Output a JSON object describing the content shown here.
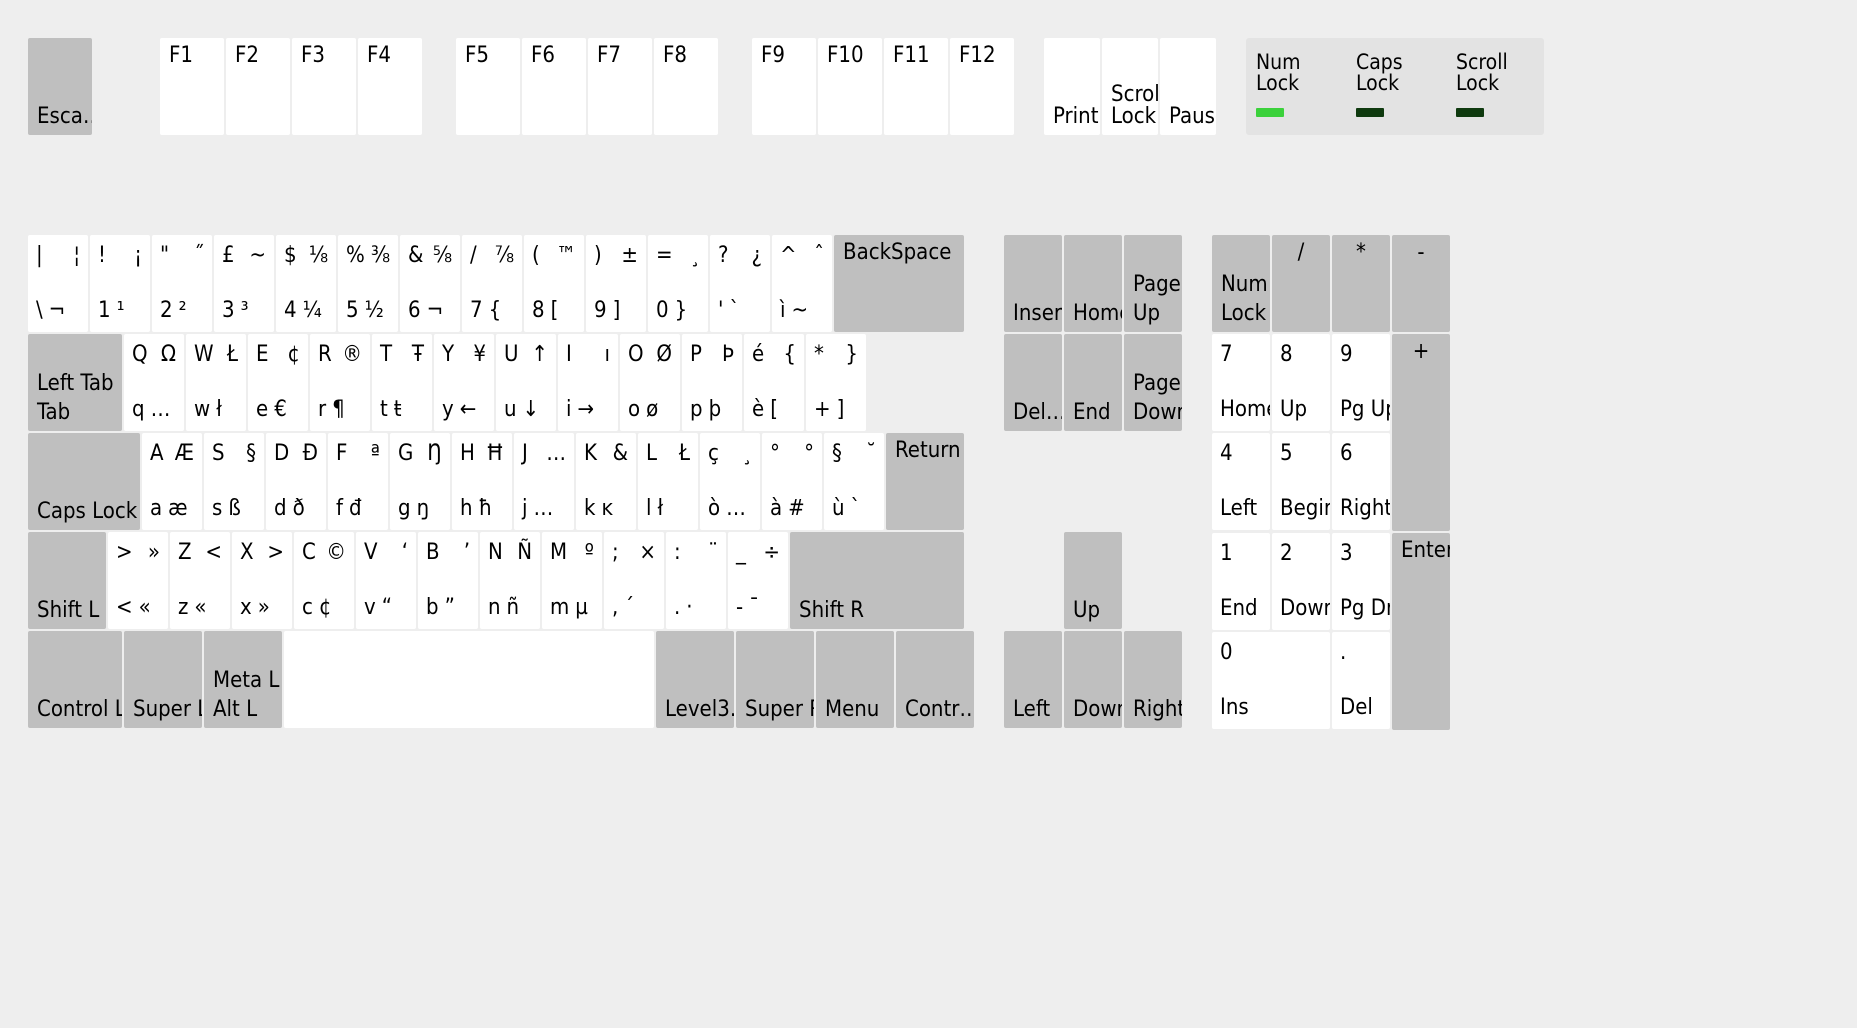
{
  "func": {
    "esc": "Esca…",
    "f1": "F1",
    "f2": "F2",
    "f3": "F3",
    "f4": "F4",
    "f5": "F5",
    "f6": "F6",
    "f7": "F7",
    "f8": "F8",
    "f9": "F9",
    "f10": "F10",
    "f11": "F11",
    "f12": "F12",
    "print": "Print",
    "scrolllock": "Scroll Lock",
    "pause": "Pause"
  },
  "indicators": {
    "num": {
      "label": "Num Lock",
      "on": true
    },
    "caps": {
      "label": "Caps Lock",
      "on": false
    },
    "scroll": {
      "label": "Scroll Lock",
      "on": false
    }
  },
  "r1": {
    "k0": {
      "a": "|",
      "b": "¦",
      "c": "\\",
      "d": "¬"
    },
    "k1": {
      "a": "!",
      "b": "¡",
      "c": "1",
      "d": "¹"
    },
    "k2": {
      "a": "\"",
      "b": "˝",
      "c": "2",
      "d": "²"
    },
    "k3": {
      "a": "£",
      "b": "~",
      "c": "3",
      "d": "³"
    },
    "k4": {
      "a": "$",
      "b": "⅛",
      "c": "4",
      "d": "¼"
    },
    "k5": {
      "a": "%",
      "b": "⅜",
      "c": "5",
      "d": "½"
    },
    "k6": {
      "a": "&",
      "b": "⅝",
      "c": "6",
      "d": "¬"
    },
    "k7": {
      "a": "/",
      "b": "⅞",
      "c": "7",
      "d": "{"
    },
    "k8": {
      "a": "(",
      "b": "™",
      "c": "8",
      "d": "["
    },
    "k9": {
      "a": ")",
      "b": "±",
      "c": "9",
      "d": "]"
    },
    "k10": {
      "a": "=",
      "b": "¸",
      "c": "0",
      "d": "}"
    },
    "k11": {
      "a": "?",
      "b": "¿",
      "c": "'",
      "d": "`"
    },
    "k12": {
      "a": "^",
      "b": "ˆ",
      "c": "ì",
      "d": "~"
    },
    "bksp": "BackSpace"
  },
  "r2": {
    "tab": {
      "top": "Left Tab",
      "bot": "Tab"
    },
    "q": {
      "a": "Q",
      "b": "Ω",
      "c": "q",
      "d": "…"
    },
    "w": {
      "a": "W",
      "b": "Ł",
      "c": "w",
      "d": "ł"
    },
    "e": {
      "a": "E",
      "b": "¢",
      "c": "e",
      "d": "€"
    },
    "r": {
      "a": "R",
      "b": "®",
      "c": "r",
      "d": "¶"
    },
    "t": {
      "a": "T",
      "b": "Ŧ",
      "c": "t",
      "d": "ŧ"
    },
    "y": {
      "a": "Y",
      "b": "¥",
      "c": "y",
      "d": "←"
    },
    "u": {
      "a": "U",
      "b": "↑",
      "c": "u",
      "d": "↓"
    },
    "i": {
      "a": "I",
      "b": "ı",
      "c": "i",
      "d": "→"
    },
    "o": {
      "a": "O",
      "b": "Ø",
      "c": "o",
      "d": "ø"
    },
    "p": {
      "a": "P",
      "b": "Þ",
      "c": "p",
      "d": "þ"
    },
    "br1": {
      "a": "é",
      "b": "{",
      "c": "è",
      "d": "["
    },
    "br2": {
      "a": "*",
      "b": "}",
      "c": "+",
      "d": "]"
    }
  },
  "r3": {
    "caps": "Caps Lock",
    "a": {
      "a": "A",
      "b": "Æ",
      "c": "a",
      "d": "æ"
    },
    "s": {
      "a": "S",
      "b": "§",
      "c": "s",
      "d": "ß"
    },
    "d": {
      "a": "D",
      "b": "Đ",
      "c": "d",
      "d": "ð"
    },
    "f": {
      "a": "F",
      "b": "ª",
      "c": "f",
      "d": "đ"
    },
    "g": {
      "a": "G",
      "b": "Ŋ",
      "c": "g",
      "d": "ŋ"
    },
    "h": {
      "a": "H",
      "b": "Ħ",
      "c": "h",
      "d": "ħ"
    },
    "j": {
      "a": "J",
      "b": "…",
      "c": "j",
      "d": "…"
    },
    "k": {
      "a": "K",
      "b": "&",
      "c": "k",
      "d": "ĸ"
    },
    "l": {
      "a": "L",
      "b": "Ł",
      "c": "l",
      "d": "ł"
    },
    "sc1": {
      "a": "ç",
      "b": "¸",
      "c": "ò",
      "d": "…"
    },
    "sc2": {
      "a": "°",
      "b": "°",
      "c": "à",
      "d": "#"
    },
    "sc3": {
      "a": "§",
      "b": "˘",
      "c": "ù",
      "d": "`"
    },
    "ret": "Return"
  },
  "r4": {
    "lshift": "Shift L",
    "lt": {
      "a": ">",
      "b": "»",
      "c": "<",
      "d": "«"
    },
    "z": {
      "a": "Z",
      "b": "<",
      "c": "z",
      "d": "«"
    },
    "x": {
      "a": "X",
      "b": ">",
      "c": "x",
      "d": "»"
    },
    "c": {
      "a": "C",
      "b": "©",
      "c": "c",
      "d": "¢"
    },
    "v": {
      "a": "V",
      "b": "‘",
      "c": "v",
      "d": "“"
    },
    "b": {
      "a": "B",
      "b": "’",
      "c": "b",
      "d": "”"
    },
    "n": {
      "a": "N",
      "b": "Ñ",
      "c": "n",
      "d": "ñ"
    },
    "m": {
      "a": "M",
      "b": "º",
      "c": "m",
      "d": "µ"
    },
    "cm": {
      "a": ";",
      "b": "×",
      "c": ",",
      "d": "´"
    },
    "pd": {
      "a": ":",
      "b": "¨",
      "c": ".",
      "d": "·"
    },
    "sl": {
      "a": "_",
      "b": "÷",
      "c": "-",
      "d": "¯"
    },
    "rshift": "Shift R"
  },
  "r5": {
    "lctrl": "Control L",
    "lsuper": "Super L",
    "lalt_top": "Meta L",
    "lalt_bot": "Alt L",
    "level3": "Level3…",
    "rsuper": "Super R",
    "menu": "Menu",
    "rctrl": "Contr…"
  },
  "nav": {
    "ins": "Insert",
    "home": "Home",
    "pgup_top": "Page",
    "pgup_bot": "Up",
    "del": "Del…",
    "end": "End",
    "pgdn_top": "Page",
    "pgdn_bot": "Down",
    "up": "Up",
    "left": "Left",
    "down": "Down",
    "right": "Right"
  },
  "np": {
    "numlock_top": "Num",
    "numlock_bot": "Lock",
    "div": "/",
    "mul": "*",
    "sub": "-",
    "k7": {
      "a": "7",
      "c": "Home"
    },
    "k8": {
      "a": "8",
      "c": "Up"
    },
    "k9": {
      "a": "9",
      "c": "Pg Up"
    },
    "add": "+",
    "k4": {
      "a": "4",
      "c": "Left"
    },
    "k5": {
      "a": "5",
      "c": "Begin"
    },
    "k6": {
      "a": "6",
      "c": "Right"
    },
    "k1": {
      "a": "1",
      "c": "End"
    },
    "k2": {
      "a": "2",
      "c": "Down"
    },
    "k3": {
      "a": "3",
      "c": "Pg Dn"
    },
    "enter": "Enter",
    "k0": {
      "a": "0",
      "c": "Ins"
    },
    "kdot": {
      "a": ".",
      "c": "Del"
    }
  }
}
